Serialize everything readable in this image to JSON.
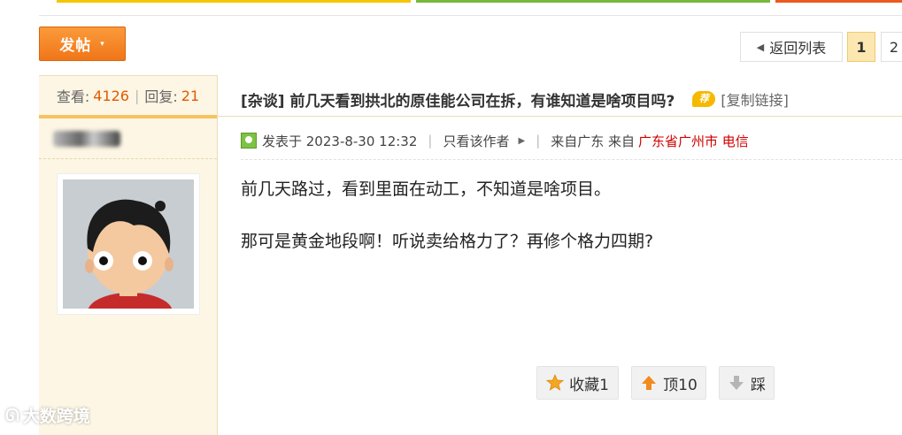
{
  "colors": {
    "bar_yellow": "#f5c500",
    "bar_green": "#78b83b",
    "bar_red": "#ec5a1f",
    "accent_orange": "#f07619",
    "location_red": "#d00000",
    "stat_number": "#e05a00"
  },
  "toolbar": {
    "post_label": "发帖",
    "post_caret": "▾",
    "back_label": "返回列表",
    "pages": [
      "1",
      "2"
    ]
  },
  "sidebar": {
    "views_label": "查看:",
    "views_count": "4126",
    "replies_label": "回复:",
    "replies_count": "21"
  },
  "thread": {
    "category": "[杂谈]",
    "title": "前几天看到拱北的原佳能公司在拆，有谁知道是啥项目吗?",
    "rec_icon": "荐",
    "copy_link": "[复制链接]"
  },
  "post": {
    "posted_at": "发表于 2023-8-30 12:32",
    "only_author": "只看该作者",
    "from_prefix": "来自广东 来自",
    "from_location": "广东省广州市 电信",
    "paragraphs": [
      "前几天路过，看到里面在动工，不知道是啥项目。",
      "那可是黄金地段啊！听说卖给格力了？再修个格力四期?"
    ]
  },
  "actions": {
    "favorite": "收藏1",
    "up": "顶10",
    "down": "踩"
  },
  "watermark": "大数跨境"
}
